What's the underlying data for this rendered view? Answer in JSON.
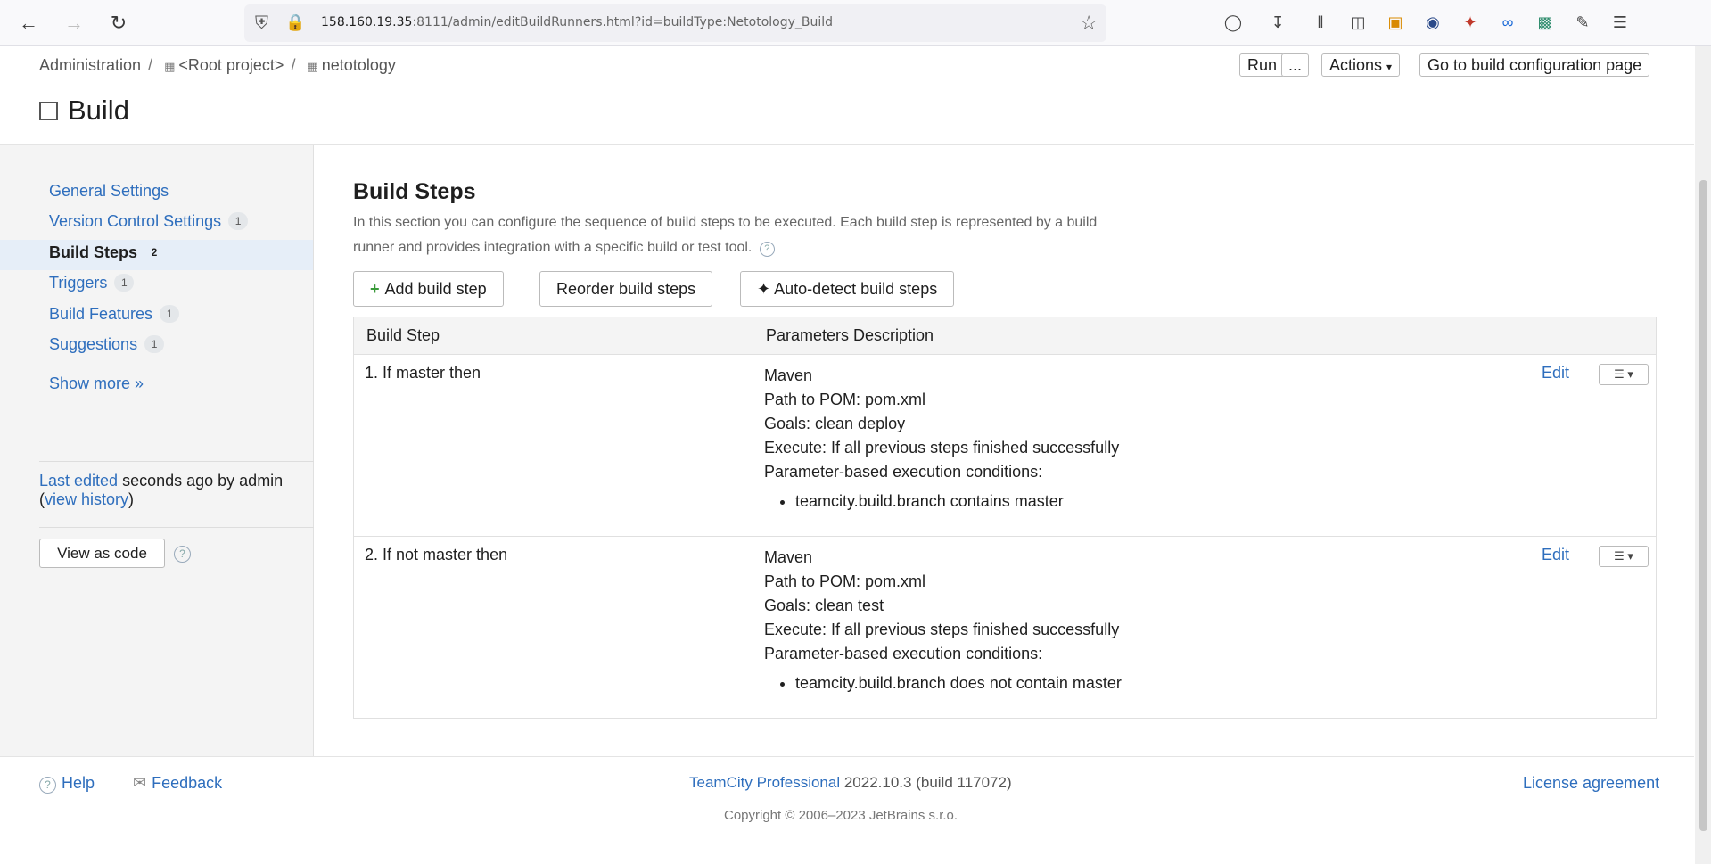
{
  "browser": {
    "url_host": "158.160.19.35",
    "url_rest": ":8111/admin/editBuildRunners.html?id=buildType:Netotology_Build"
  },
  "breadcrumb": {
    "admin": "Administration",
    "root": "<Root project>",
    "project": "netotology"
  },
  "header": {
    "title": "Build",
    "run": "Run",
    "more": "...",
    "actions": "Actions",
    "go_to_config": "Go to build configuration page"
  },
  "sidebar": {
    "items": [
      {
        "label": "General Settings",
        "badge": ""
      },
      {
        "label": "Version Control Settings",
        "badge": "1"
      },
      {
        "label": "Build Steps",
        "badge": "2"
      },
      {
        "label": "Triggers",
        "badge": "1"
      },
      {
        "label": "Build Features",
        "badge": "1"
      },
      {
        "label": "Suggestions",
        "badge": "1"
      }
    ],
    "show_more": "Show more »",
    "last_edited_link": "Last edited",
    "last_edited_text": " seconds ago by admin",
    "view_history": "view history",
    "view_as_code": "View as code"
  },
  "main": {
    "title": "Build Steps",
    "description": "In this section you can configure the sequence of build steps to be executed. Each build step is represented by a build runner and provides integration with a specific build or test tool.",
    "add_step": "Add build step",
    "reorder": "Reorder build steps",
    "autodetect": "Auto-detect build steps",
    "col_step": "Build Step",
    "col_params": "Parameters Description",
    "edit_label": "Edit",
    "steps": [
      {
        "name": "1. If master then",
        "runner": "Maven",
        "pom": "Path to POM: pom.xml",
        "goals": "Goals: clean deploy",
        "execute": "Execute: If all previous steps finished successfully",
        "cond_title": "Parameter-based execution conditions:",
        "condition": "teamcity.build.branch contains master"
      },
      {
        "name": "2. If not master then",
        "runner": "Maven",
        "pom": "Path to POM: pom.xml",
        "goals": "Goals: clean test",
        "execute": "Execute: If all previous steps finished successfully",
        "cond_title": "Parameter-based execution conditions:",
        "condition": "teamcity.build.branch does not contain master"
      }
    ]
  },
  "footer": {
    "help": "Help",
    "feedback": "Feedback",
    "product": "TeamCity Professional",
    "version": " 2022.10.3 (build 117072)",
    "license": "License agreement",
    "copyright": "Copyright © 2006–2023 JetBrains s.r.o."
  },
  "colors": {
    "link": "#2e6ebd",
    "sidebar_bg": "#f4f4f4",
    "active_item_bg": "#e6eef8"
  }
}
